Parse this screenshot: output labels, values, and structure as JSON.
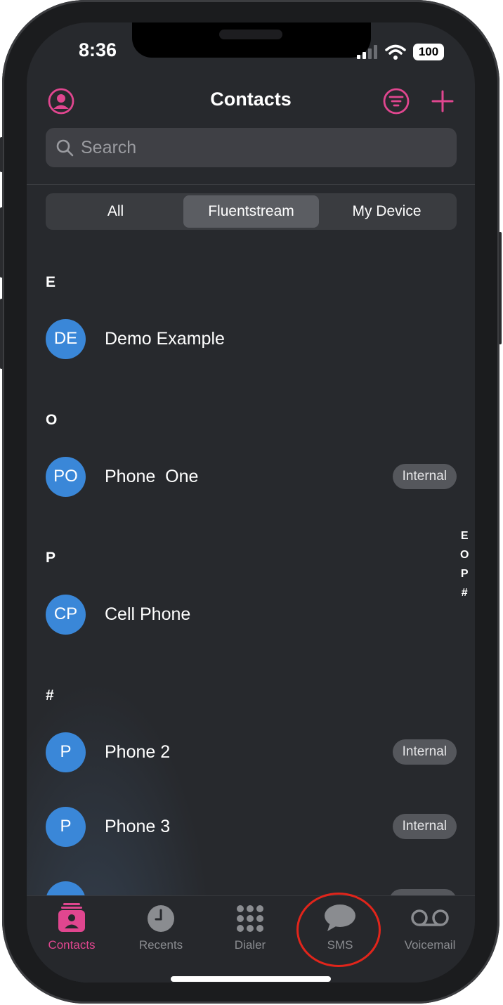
{
  "status": {
    "time": "8:36",
    "battery": "100"
  },
  "header": {
    "title": "Contacts"
  },
  "search": {
    "placeholder": "Search"
  },
  "segments": [
    {
      "label": "All",
      "active": false
    },
    {
      "label": "Fluentstream",
      "active": true
    },
    {
      "label": "My Device",
      "active": false
    }
  ],
  "sections": [
    {
      "letter": "E",
      "contacts": [
        {
          "initials": "DE",
          "name": "Demo Example",
          "badge": ""
        }
      ]
    },
    {
      "letter": "O",
      "contacts": [
        {
          "initials": "PO",
          "name": "Phone  One",
          "badge": "Internal"
        }
      ]
    },
    {
      "letter": "P",
      "contacts": [
        {
          "initials": "CP",
          "name": "Cell Phone",
          "badge": ""
        }
      ]
    },
    {
      "letter": "#",
      "contacts": [
        {
          "initials": "P",
          "name": "Phone 2",
          "badge": "Internal"
        },
        {
          "initials": "P",
          "name": "Phone 3",
          "badge": "Internal"
        }
      ]
    }
  ],
  "index_letters": [
    "E",
    "O",
    "P",
    "#"
  ],
  "tabs": [
    {
      "label": "Contacts",
      "icon": "contacts-icon",
      "active": true
    },
    {
      "label": "Recents",
      "icon": "clock-icon",
      "active": false
    },
    {
      "label": "Dialer",
      "icon": "keypad-icon",
      "active": false
    },
    {
      "label": "SMS",
      "icon": "chat-bubble-icon",
      "active": false
    },
    {
      "label": "Voicemail",
      "icon": "voicemail-icon",
      "active": false
    }
  ],
  "colors": {
    "accent": "#e0468f",
    "avatar": "#3a87d8",
    "annotation": "#e1251b"
  }
}
